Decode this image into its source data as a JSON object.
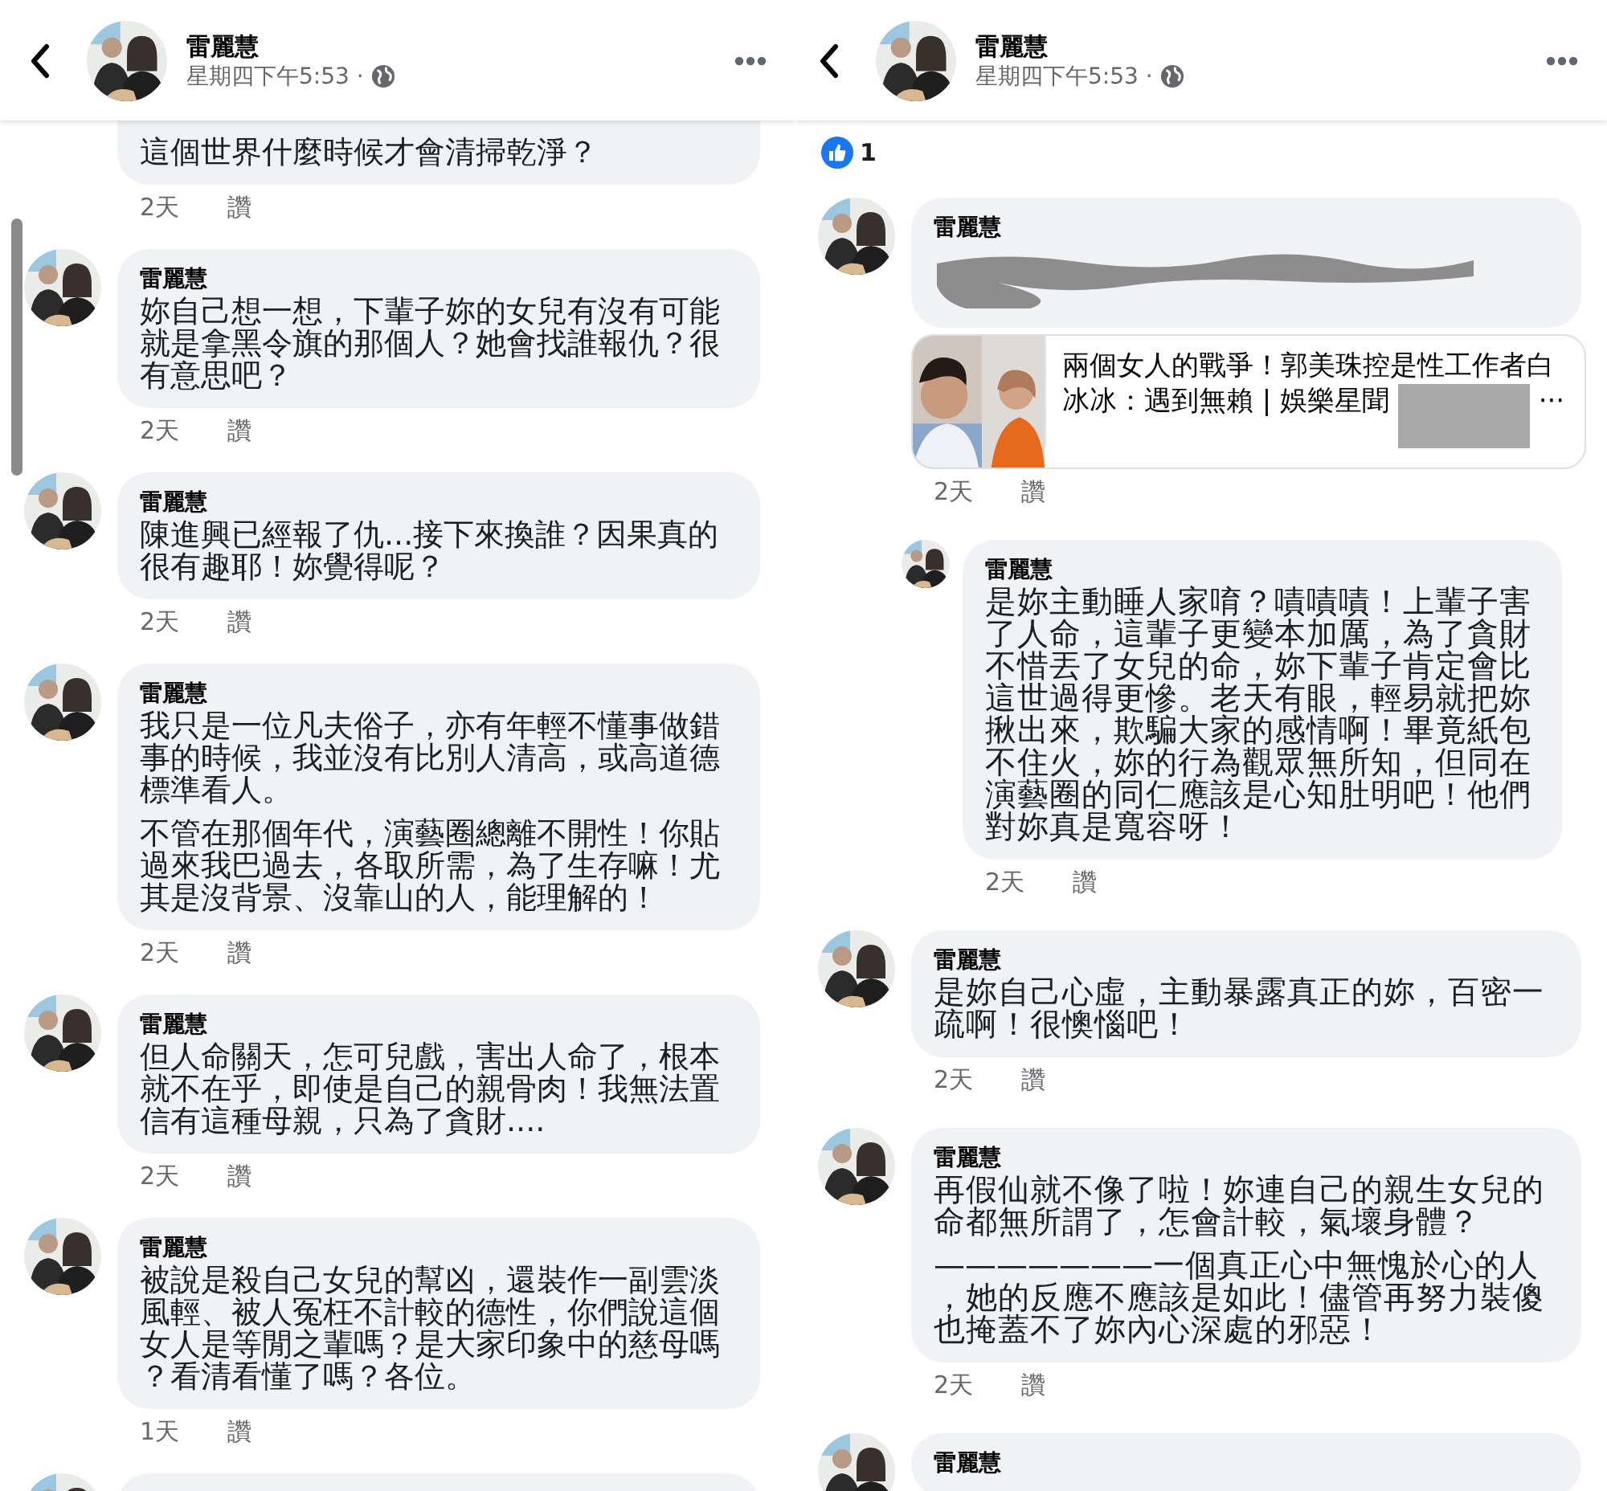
{
  "screens": [
    {
      "header": {
        "name": "雷麗慧",
        "time": "星期四下午5:53 ·"
      },
      "scrollbar": true,
      "comments": [
        {
          "kind": "comment",
          "text": [
            "這個世界什麼時候才會清掃乾淨？"
          ],
          "age": "2天",
          "like": "讚"
        },
        {
          "kind": "comment",
          "author": "雷麗慧",
          "text": [
            "妳自己想一想，下輩子妳的女兒有沒有可能就是拿黑令旗的那個人？她會找誰報仇？很有意思吧？"
          ],
          "age": "2天",
          "like": "讚"
        },
        {
          "kind": "comment",
          "author": "雷麗慧",
          "text": [
            "陳進興已經報了仇...接下來換誰？因果真的很有趣耶！妳覺得呢？"
          ],
          "age": "2天",
          "like": "讚"
        },
        {
          "kind": "comment",
          "author": "雷麗慧",
          "text": [
            "我只是一位凡夫俗子，亦有年輕不懂事做錯事的時候，我並沒有比別人清高，或高道德標準看人。",
            "不管在那個年代，演藝圈總離不開性！你貼過來我巴過去，各取所需，為了生存嘛！尤其是沒背景、沒靠山的人，能理解的！"
          ],
          "age": "2天",
          "like": "讚"
        },
        {
          "kind": "comment",
          "author": "雷麗慧",
          "text": [
            "但人命關天，怎可兒戲，害出人命了，根本就不在乎，即使是自己的親骨肉！我無法置信有這種母親，只為了貪財...."
          ],
          "age": "2天",
          "like": "讚"
        },
        {
          "kind": "comment",
          "author": "雷麗慧",
          "text": [
            "被說是殺自己女兒的幫凶，還裝作一副雲淡風輕、被人冤枉不計較的德性，你們說這個女人是等閒之輩嗎？是大家印象中的慈母嗎？看清看懂了嗎？各位。"
          ],
          "age": "1天",
          "like": "讚"
        },
        {
          "kind": "comment"
        }
      ]
    },
    {
      "header": {
        "name": "雷麗慧",
        "time": "星期四下午5:53 ·"
      },
      "reactions": {
        "count": "1"
      },
      "comments": [
        {
          "kind": "comment",
          "author": "雷麗慧",
          "link": {
            "title": "兩個女人的戰爭！郭美珠控是性工作者白冰冰：遇到無賴 | 娛樂星聞",
            "ellipsis": "···"
          },
          "age": "2天",
          "like": "讚"
        },
        {
          "kind": "reply",
          "author": "雷麗慧",
          "text": [
            "是妳主動睡人家唷？嘖嘖嘖！上輩子害了人命，這輩子更變本加厲，為了貪財不惜丟了女兒的命，妳下輩子肯定會比這世過得更慘。老天有眼，輕易就把妳揪出來，欺騙大家的感情啊！畢竟紙包不住火，妳的行為觀眾無所知，但同在演藝圈的同仁應該是心知肚明吧！他們對妳真是寬容呀！"
          ],
          "age": "2天",
          "like": "讚"
        },
        {
          "kind": "comment",
          "author": "雷麗慧",
          "text": [
            "是妳自己心虛，主動暴露真正的妳，百密一疏啊！很懊惱吧！"
          ],
          "age": "2天",
          "like": "讚"
        },
        {
          "kind": "comment",
          "author": "雷麗慧",
          "text": [
            "再假仙就不像了啦！妳連自己的親生女兒的命都無所謂了，怎會計較，氣壞身體？",
            "———————一個真正心中無愧於心的人，她的反應不應該是如此！儘管再努力裝傻也掩蓋不了妳內心深處的邪惡！"
          ],
          "age": "2天",
          "like": "讚"
        },
        {
          "kind": "comment",
          "author": "雷麗慧"
        }
      ]
    }
  ]
}
